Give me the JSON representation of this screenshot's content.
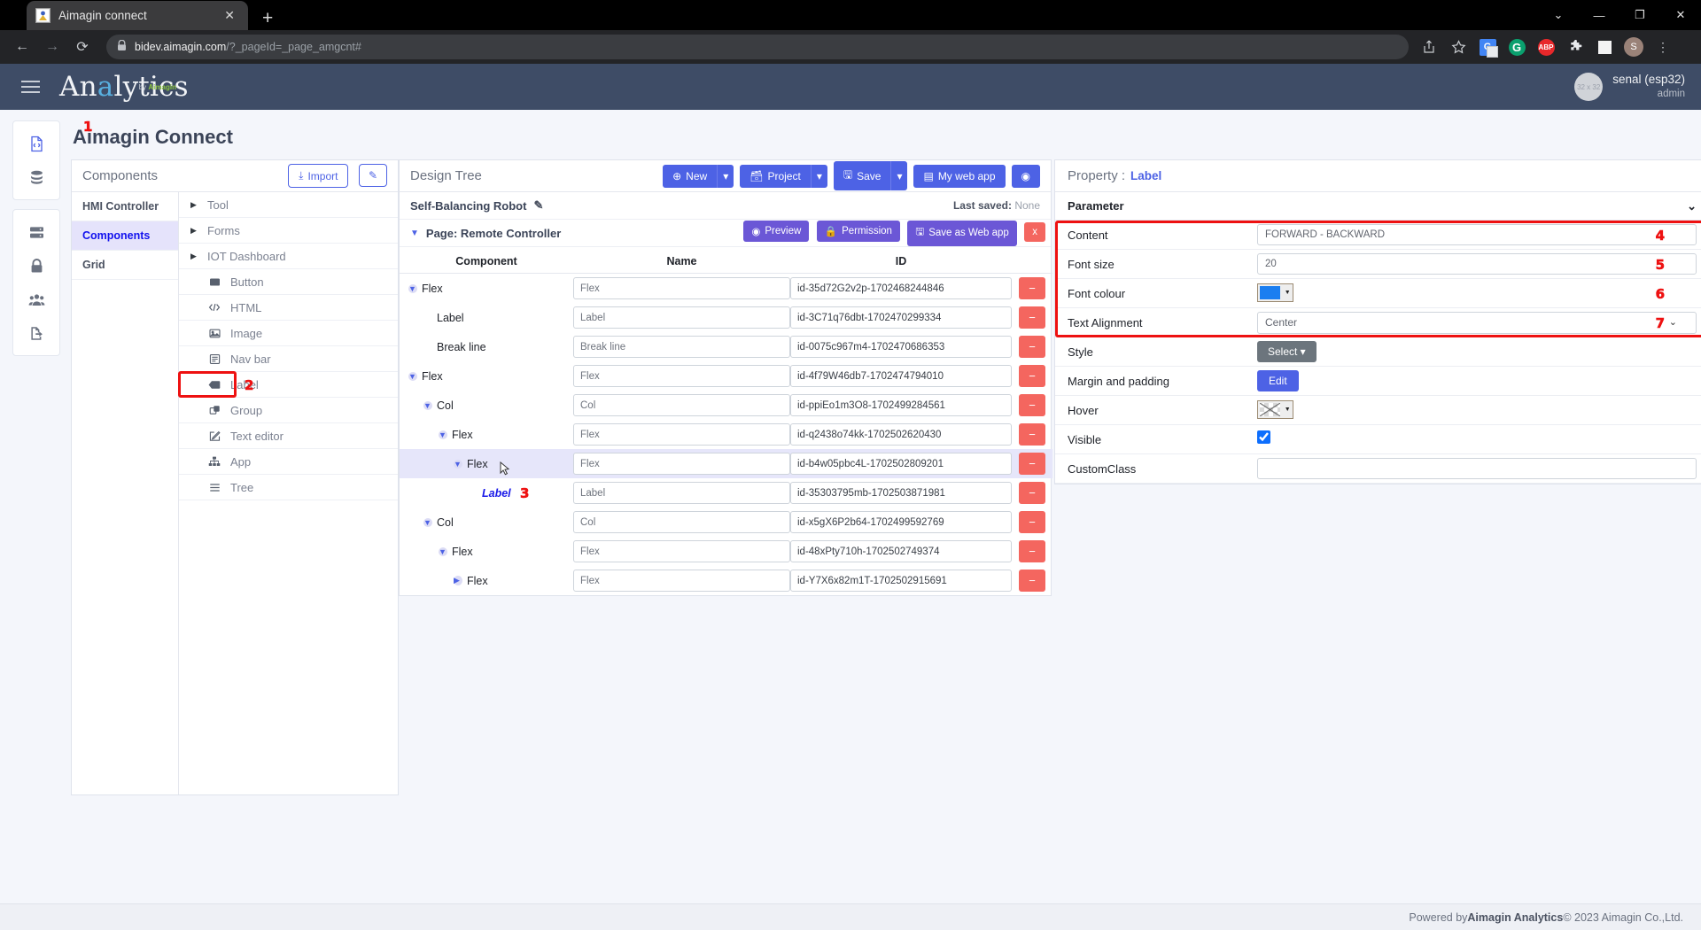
{
  "browser": {
    "tab_title": "Aimagin connect",
    "tab_close": "✕",
    "new_tab": "+",
    "window_controls": [
      "⌄",
      "—",
      "❐",
      "✕"
    ],
    "nav": {
      "back": "←",
      "forward": "→",
      "reload": "⟳"
    },
    "url_domain": "bidev.aimagin.com",
    "url_path": "/?_pageId=_page_amgcnt#",
    "lock_icon": "🔒",
    "toolbar_icons": [
      "share-icon",
      "star-icon",
      "google-translate-icon",
      "grammarly-icon",
      "adblock-plus-icon",
      "extensions-puzzle-icon",
      "sidepanel-icon",
      "profile-avatar",
      "chrome-menu-icon"
    ],
    "profile_initial": "S",
    "abp_label": "ABP",
    "grammarly_label": "G",
    "translate_label": "G",
    "menu_dots": "⋮"
  },
  "app_header": {
    "logo_pre": "An",
    "logo_hl": "a",
    "logo_post": "lytics",
    "logo_sub_pre": "by ",
    "logo_sub_brand": "Aimagin",
    "user_name": "senal (esp32)",
    "user_role": "admin",
    "avatar_placeholder": "32 x 32"
  },
  "rail": {
    "groups": [
      {
        "items": [
          {
            "name": "code-file-icon",
            "active": true
          },
          {
            "name": "database-icon",
            "active": false
          }
        ]
      },
      {
        "items": [
          {
            "name": "server-icon",
            "active": false
          },
          {
            "name": "lock-icon",
            "active": false
          },
          {
            "name": "users-icon",
            "active": false
          },
          {
            "name": "logout-icon",
            "active": false
          }
        ]
      }
    ]
  },
  "page_title": "Aimagin Connect",
  "components_panel": {
    "title": "Components",
    "import_label": "Import",
    "import_icon": "⤓",
    "edit_icon": "✎",
    "categories": [
      {
        "label": "HMI Controller",
        "active": false
      },
      {
        "label": "Components",
        "active": true
      },
      {
        "label": "Grid",
        "active": false
      }
    ],
    "items": [
      {
        "label": "Tool",
        "kind": "group",
        "icon": "caret-right-icon"
      },
      {
        "label": "Forms",
        "kind": "group",
        "icon": "caret-right-icon"
      },
      {
        "label": "IOT Dashboard",
        "kind": "group",
        "icon": "caret-right-icon"
      },
      {
        "label": "Button",
        "kind": "leaf",
        "icon": "button-icon"
      },
      {
        "label": "HTML",
        "kind": "leaf",
        "icon": "code-icon"
      },
      {
        "label": "Image",
        "kind": "leaf",
        "icon": "image-icon"
      },
      {
        "label": "Nav bar",
        "kind": "leaf",
        "icon": "navbar-icon"
      },
      {
        "label": "Label",
        "kind": "leaf",
        "icon": "label-icon",
        "highlighted": true
      },
      {
        "label": "Group",
        "kind": "leaf",
        "icon": "group-icon"
      },
      {
        "label": "Text editor",
        "kind": "leaf",
        "icon": "text-editor-icon"
      },
      {
        "label": "App",
        "kind": "leaf",
        "icon": "app-icon"
      },
      {
        "label": "Tree",
        "kind": "leaf",
        "icon": "tree-icon"
      }
    ]
  },
  "design_tree": {
    "title": "Design Tree",
    "toolbar": [
      {
        "label": "New",
        "icon": "plus-circle-icon",
        "has_caret": true
      },
      {
        "label": "Project",
        "icon": "briefcase-icon",
        "has_caret": true
      },
      {
        "label": "Save",
        "icon": "save-icon",
        "has_caret": true
      },
      {
        "label": "My web app",
        "icon": "webapp-icon",
        "has_caret": false
      },
      {
        "label": "",
        "icon": "eye-icon",
        "has_caret": false
      }
    ],
    "project_name": "Self-Balancing Robot",
    "project_edit_icon": "✎",
    "last_saved_label": "Last saved:",
    "last_saved_value": "None",
    "page_label": "Page: Remote Controller",
    "page_buttons": [
      {
        "label": "Preview",
        "icon": "eye-icon",
        "style": "purple"
      },
      {
        "label": "Permission",
        "icon": "lock-icon",
        "style": "purple"
      },
      {
        "label": "Save as Web app",
        "icon": "save-icon",
        "style": "purple"
      },
      {
        "label": "x",
        "icon": "close-icon",
        "style": "red"
      }
    ],
    "columns": [
      "Component",
      "Name",
      "ID"
    ],
    "rows": [
      {
        "component": "Flex",
        "indent": 0,
        "toggle": "down",
        "name": "Flex",
        "id": "id-35d72G2v2p-1702468244846"
      },
      {
        "component": "Label",
        "indent": 1,
        "toggle": "none",
        "name": "Label",
        "id": "id-3C71q76dbt-1702470299334"
      },
      {
        "component": "Break line",
        "indent": 1,
        "toggle": "none",
        "name": "Break line",
        "id": "id-0075c967m4-1702470686353"
      },
      {
        "component": "Flex",
        "indent": 0,
        "toggle": "down",
        "name": "Flex",
        "id": "id-4f79W46db7-1702474794010"
      },
      {
        "component": "Col",
        "indent": 1,
        "toggle": "down",
        "name": "Col",
        "id": "id-ppiEo1m3O8-1702499284561"
      },
      {
        "component": "Flex",
        "indent": 2,
        "toggle": "down",
        "name": "Flex",
        "id": "id-q2438o74kk-1702502620430"
      },
      {
        "component": "Flex",
        "indent": 3,
        "toggle": "down",
        "name": "Flex",
        "id": "id-b4w05pbc4L-1702502809201",
        "selected": true,
        "cursor": true
      },
      {
        "component": "Label",
        "indent": 4,
        "toggle": "none",
        "name": "Label",
        "id": "id-35303795mb-1702503871981",
        "label_selected": true,
        "annot": "3"
      },
      {
        "component": "Col",
        "indent": 1,
        "toggle": "down",
        "name": "Col",
        "id": "id-x5gX6P2b64-1702499592769"
      },
      {
        "component": "Flex",
        "indent": 2,
        "toggle": "down",
        "name": "Flex",
        "id": "id-48xPty710h-1702502749374"
      },
      {
        "component": "Flex",
        "indent": 3,
        "toggle": "right",
        "name": "Flex",
        "id": "id-Y7X6x82m1T-1702502915691"
      }
    ],
    "delete_icon": "−"
  },
  "property_panel": {
    "title_label": "Property :",
    "title_value": "Label",
    "section_title": "Parameter",
    "collapse_icon": "⌄",
    "rows": [
      {
        "label": "Content",
        "type": "text",
        "value": "FORWARD - BACKWARD",
        "annot": "4"
      },
      {
        "label": "Font size",
        "type": "text",
        "value": "20",
        "annot": "5"
      },
      {
        "label": "Font colour",
        "type": "color",
        "value": "#1b7ef0",
        "annot": "6"
      },
      {
        "label": "Text Alignment",
        "type": "select",
        "value": "Center",
        "annot": "7"
      },
      {
        "label": "Style",
        "type": "button-select",
        "value": "Select"
      },
      {
        "label": "Margin and padding",
        "type": "button-edit",
        "value": "Edit"
      },
      {
        "label": "Hover",
        "type": "hover-color",
        "value": ""
      },
      {
        "label": "Visible",
        "type": "checkbox",
        "value": "checked"
      },
      {
        "label": "CustomClass",
        "type": "text",
        "value": ""
      }
    ]
  },
  "annotations": {
    "a1": "1",
    "a2": "2",
    "a3": "3",
    "a4": "4",
    "a5": "5",
    "a6": "6",
    "a7": "7"
  },
  "footer": {
    "pre": "Powered by ",
    "brand": "Aimagin Analytics",
    "post": " © 2023 Aimagin Co.,Ltd."
  },
  "colors": {
    "accent": "#4d62e5",
    "header_bg": "#3e4c66",
    "danger": "#f4665f",
    "annotation_red": "#ee1111",
    "selected_row": "#e6e6fa"
  }
}
